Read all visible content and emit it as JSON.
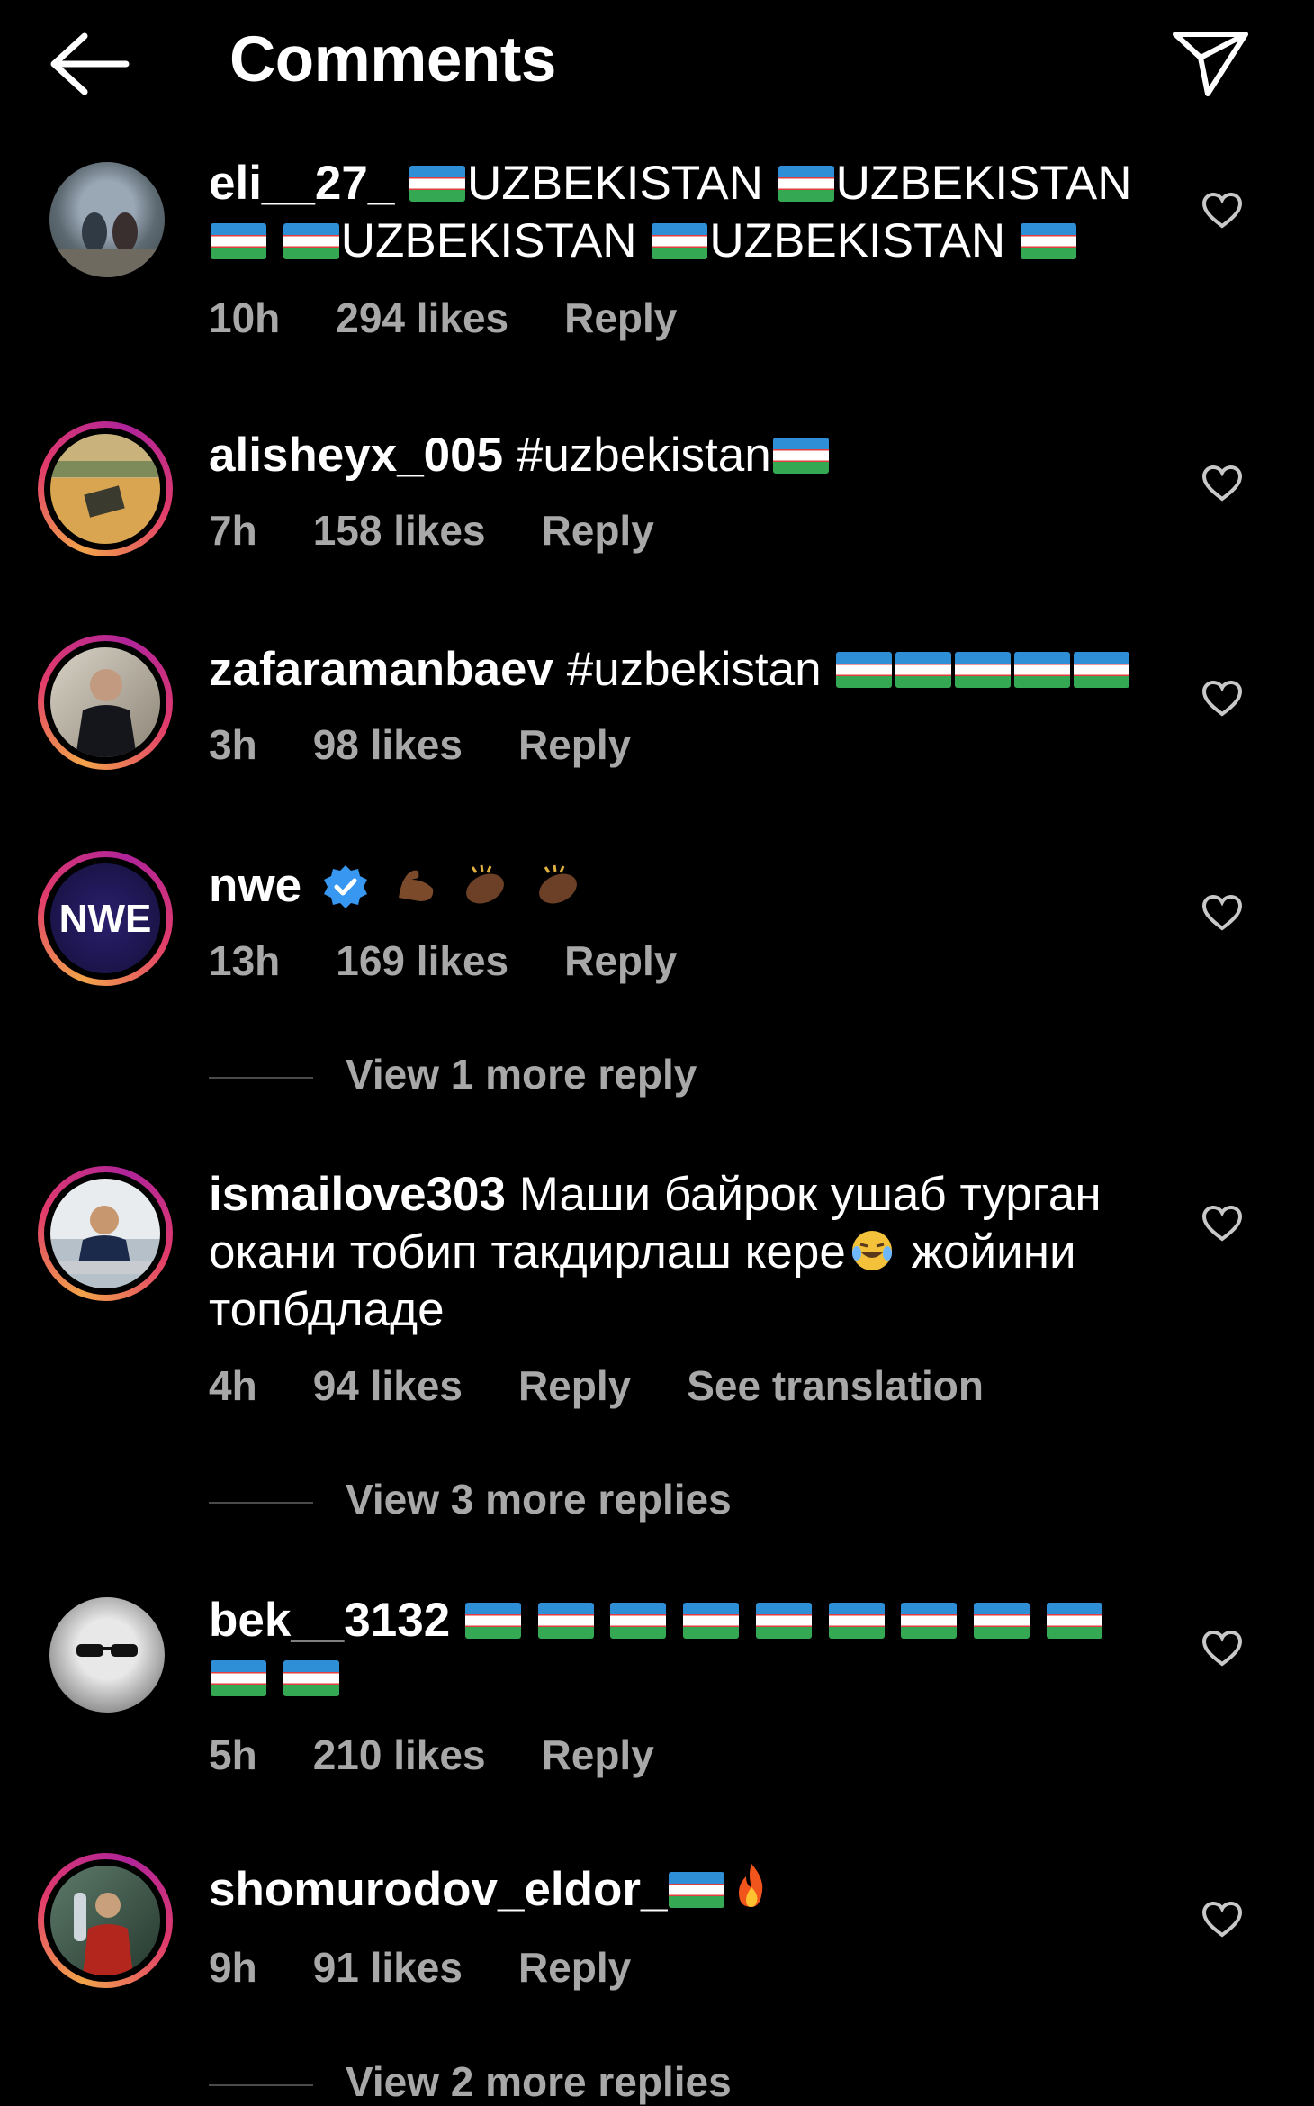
{
  "header": {
    "title": "Comments",
    "back_icon": "arrow-left-icon",
    "send_icon": "paper-plane-icon"
  },
  "comments": [
    {
      "username": "eli__27_",
      "text_parts": [
        "UZBEKISTAN",
        "UZBEKISTAN",
        "UZBEKISTAN",
        "UZBEKISTAN"
      ],
      "time": "10h",
      "likes": "294 likes",
      "reply": "Reply"
    },
    {
      "username": "alisheyx_005",
      "text": "#uzbekistan",
      "time": "7h",
      "likes": "158 likes",
      "reply": "Reply"
    },
    {
      "username": "zafaramanbaev",
      "text": "#uzbekistan",
      "time": "3h",
      "likes": "98 likes",
      "reply": "Reply"
    },
    {
      "username": "nwe",
      "verified": true,
      "time": "13h",
      "likes": "169 likes",
      "reply": "Reply",
      "view_replies": "View 1 more reply"
    },
    {
      "username": "ismailove303",
      "text": "Маши байрок ушаб турган окани тобип такдирлаш кере",
      "text_after": " жойини топбдладе",
      "time": "4h",
      "likes": "94 likes",
      "reply": "Reply",
      "translate": "See translation",
      "view_replies": "View 3 more replies"
    },
    {
      "username": "bek__3132",
      "time": "5h",
      "likes": "210 likes",
      "reply": "Reply"
    },
    {
      "username": "shomurodov_eldor_",
      "time": "9h",
      "likes": "91 likes",
      "reply": "Reply",
      "view_replies": "View 2 more replies"
    }
  ],
  "colors": {
    "background": "#000000",
    "text": "#ffffff",
    "muted": "#a8a8a8",
    "verified": "#3897f0"
  }
}
